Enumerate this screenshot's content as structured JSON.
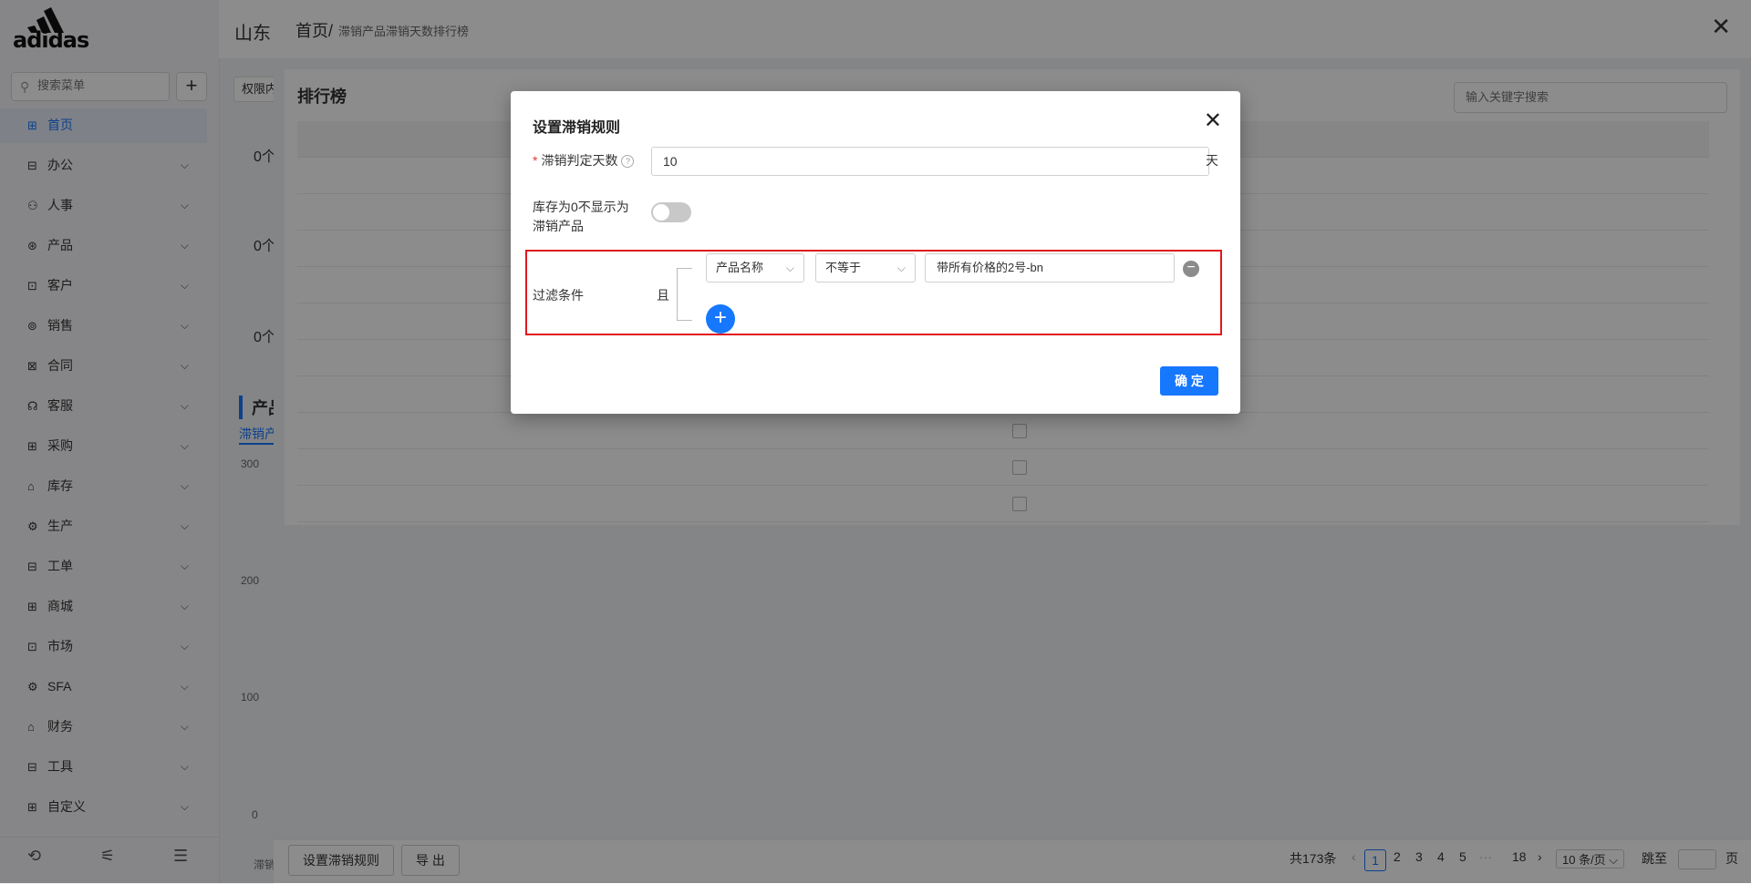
{
  "sidebar": {
    "logo_text": "adidas",
    "search_placeholder": "搜索菜单",
    "add_label": "+",
    "items": [
      {
        "label": "首页",
        "icon": "home-icon",
        "glyph": "⊞"
      },
      {
        "label": "办公",
        "icon": "office-icon",
        "glyph": "⊟"
      },
      {
        "label": "人事",
        "icon": "people-icon",
        "glyph": "⚇"
      },
      {
        "label": "产品",
        "icon": "product-icon",
        "glyph": "⊛"
      },
      {
        "label": "客户",
        "icon": "customer-icon",
        "glyph": "⊡"
      },
      {
        "label": "销售",
        "icon": "sales-icon",
        "glyph": "⊚"
      },
      {
        "label": "合同",
        "icon": "contract-icon",
        "glyph": "⊠"
      },
      {
        "label": "客服",
        "icon": "service-icon",
        "glyph": "☊"
      },
      {
        "label": "采购",
        "icon": "purchase-icon",
        "glyph": "⊞"
      },
      {
        "label": "库存",
        "icon": "inventory-icon",
        "glyph": "⌂"
      },
      {
        "label": "生产",
        "icon": "production-icon",
        "glyph": "⚙"
      },
      {
        "label": "工单",
        "icon": "ticket-icon",
        "glyph": "⊟"
      },
      {
        "label": "商城",
        "icon": "mall-icon",
        "glyph": "⊞"
      },
      {
        "label": "市场",
        "icon": "market-icon",
        "glyph": "⊡"
      },
      {
        "label": "SFA",
        "icon": "sfa-icon",
        "glyph": "⚙"
      },
      {
        "label": "财务",
        "icon": "finance-icon",
        "glyph": "⌂"
      },
      {
        "label": "工具",
        "icon": "tools-icon",
        "glyph": "⊟"
      },
      {
        "label": "自定义",
        "icon": "custom-icon",
        "glyph": "⊞"
      }
    ]
  },
  "background": {
    "company_title": "山东",
    "perm_button": "权限内",
    "stats": [
      "0个",
      "0个",
      "0个"
    ],
    "chart_title": "产品",
    "chart_tab": "滞销产",
    "y_ticks": [
      "300",
      "200",
      "100",
      "0"
    ],
    "bottom_label": "滞销"
  },
  "drawer": {
    "home": "首页/",
    "crumb": "滞销产品滞销天数排行榜",
    "card_title": "排行榜",
    "search_placeholder": "输入关键字搜索",
    "footer": {
      "set_rule_button": "设置滞销规则",
      "export_button": "导 出",
      "total": "共173条",
      "pages": [
        "1",
        "2",
        "3",
        "4",
        "5",
        "···",
        "18"
      ],
      "current_page": "1",
      "page_size": "10 条/页",
      "jump_label": "跳至",
      "page_unit": "页"
    }
  },
  "modal": {
    "title": "设置滞销规则",
    "days_label": "滞销判定天数",
    "days_value": "10",
    "days_unit": "天",
    "zero_stock_label_1": "库存为0不显示为",
    "zero_stock_label_2": "滞销产品",
    "zero_stock_on": false,
    "filter_label": "过滤条件",
    "logic": "且",
    "condition_field": "产品名称",
    "condition_operator": "不等于",
    "condition_value": "带所有价格的2号-bn",
    "confirm_button": "确 定",
    "highlight_color": "#e0181e",
    "accent_color": "#1677ff"
  }
}
